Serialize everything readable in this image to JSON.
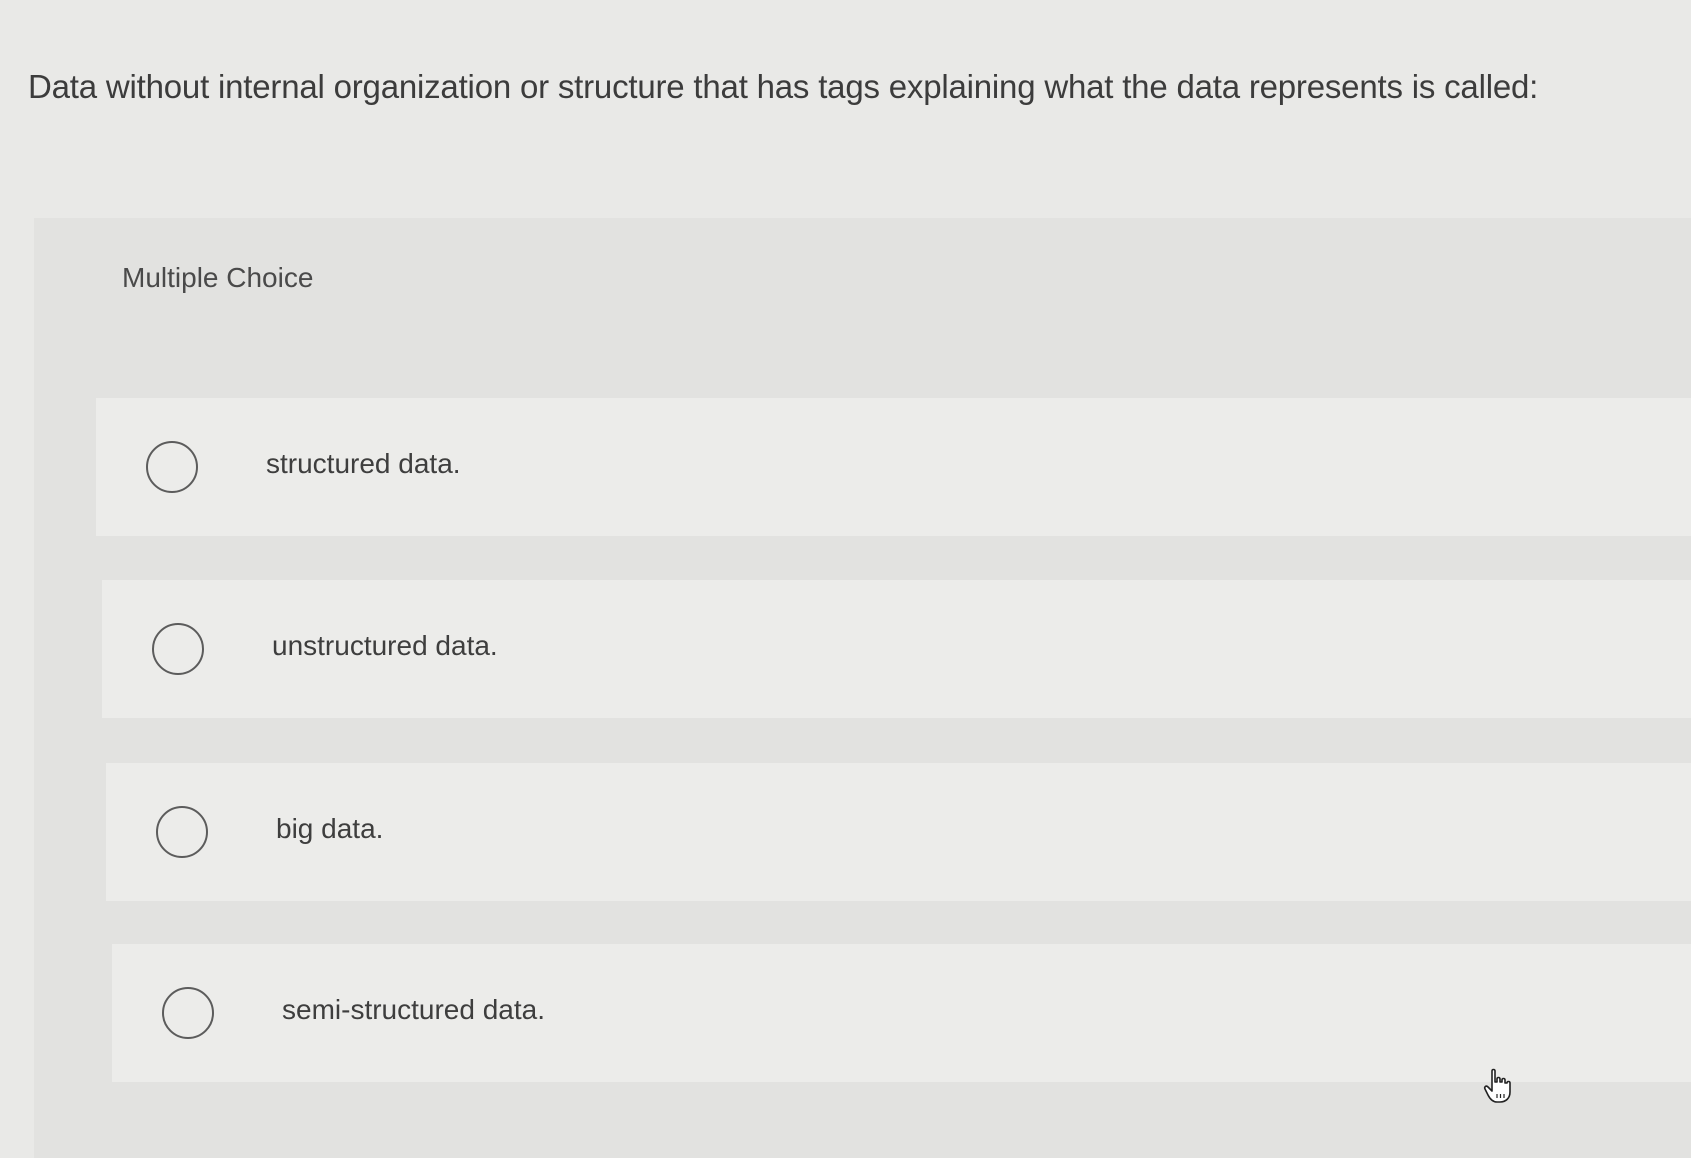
{
  "question": {
    "text": "Data without internal organization or structure that has tags explaining what the data represents is called:"
  },
  "panel": {
    "label": "Multiple Choice"
  },
  "options": [
    {
      "label": "structured data.",
      "icon": "radio-unselected-icon"
    },
    {
      "label": "unstructured data.",
      "icon": "radio-unselected-icon"
    },
    {
      "label": "big data.",
      "icon": "radio-unselected-icon"
    },
    {
      "label": "semi-structured data.",
      "icon": "radio-unselected-icon"
    }
  ],
  "cursor": {
    "icon": "hand-pointer-icon"
  },
  "colors": {
    "background": "#e9e9e7",
    "panel": "#e2e2e0",
    "option_row": "#ececea",
    "text": "#3c3c3c"
  }
}
